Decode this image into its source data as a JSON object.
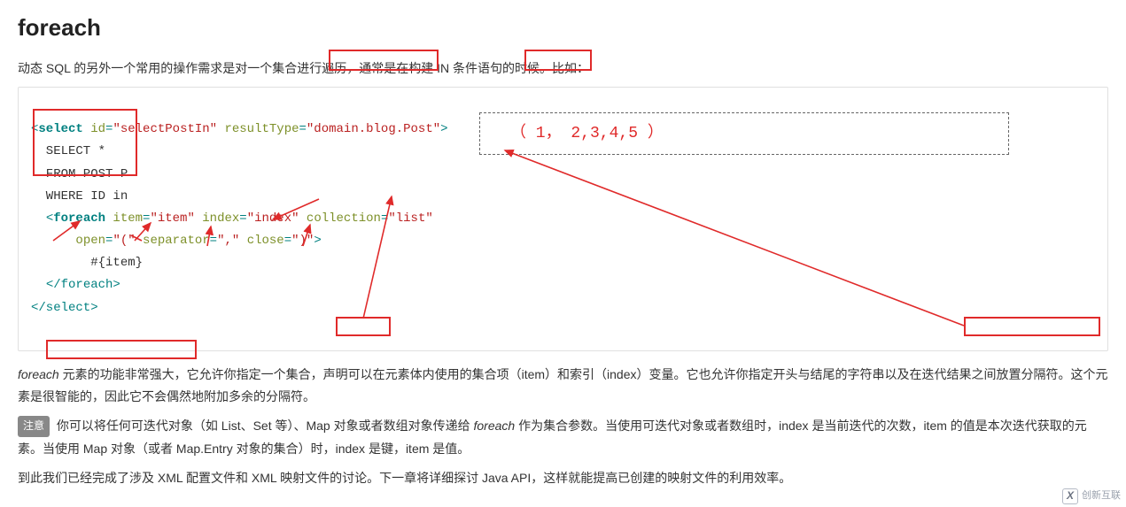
{
  "title": "foreach",
  "intro_parts": {
    "p1": "动态 SQL 的另外一个常用的操作需求是对一",
    "hl1": "个集合进行遍历，",
    "p2": "通常是在构建",
    "hl2": " IN 条件语",
    "p3": "句的时候。比如："
  },
  "code": {
    "line1": {
      "open": "<",
      "tag": "select",
      "a1": " id",
      "eq": "=",
      "v1": "\"selectPostIn\"",
      "a2": " resultType",
      "v2": "\"domain.blog.Post\"",
      "close": ">"
    },
    "sql1": "  SELECT *",
    "sql2": "  FROM POST P",
    "sql3": "  WHERE ID in",
    "fe_open": {
      "indent": "  ",
      "open": "<",
      "tag": "foreach",
      "a_item": " item",
      "v_item": "\"item\"",
      "a_index": " index",
      "v_index": "\"index\"",
      "a_coll": " collection",
      "v_coll": "\"list\""
    },
    "fe_open2": {
      "indent": "      ",
      "a_open": "open",
      "v_open": "\"(\"",
      "a_sep": " separator",
      "v_sep": "\",\"",
      "a_close": " close",
      "v_close": "\")\"",
      "end": ">"
    },
    "item_line": "        #{item}",
    "fe_close": {
      "indent": "  ",
      "text": "</foreach>"
    },
    "sel_close": {
      "text": "</select>"
    }
  },
  "annotation_value": "（ 1， 2,3,4,5 ）",
  "para2": {
    "lead_italic": "foreach",
    "seg1": " 元素的功能非常强大，它允许你指定",
    "hl_coll": "一个集合",
    "seg2": "，声明可以在元素体内使用的集合项（item）和索引（index）变量。它也允许你指定",
    "hl_trail": "开头与结尾的字符串以",
    "seg3_prefix": "及在",
    "hl_sep": "迭代结果之间放置分隔符",
    "seg4": "。这个元素是很智能的，因此它不会偶然地附加多余的分隔符。"
  },
  "note": {
    "badge": "注意",
    "text_a": " 你可以将任何可迭代对象（如 List、Set 等）、Map 对象或者数组对象传递给 ",
    "italic": "foreach",
    "text_b": " 作为集合参数。当使用可迭代对象或者数组时，index 是当前迭代的次数，item 的值是本次迭代获取的元素。当使用 Map 对象（或者 Map.Entry 对象的集合）时，index 是键，item 是值。"
  },
  "para_last": "到此我们已经完成了涉及 XML 配置文件和 XML 映射文件的讨论。下一章将详细探讨 Java API，这样就能提高已创建的映射文件的利用效率。",
  "watermark": "创新互联",
  "colors": {
    "red": "#e02a2a"
  }
}
